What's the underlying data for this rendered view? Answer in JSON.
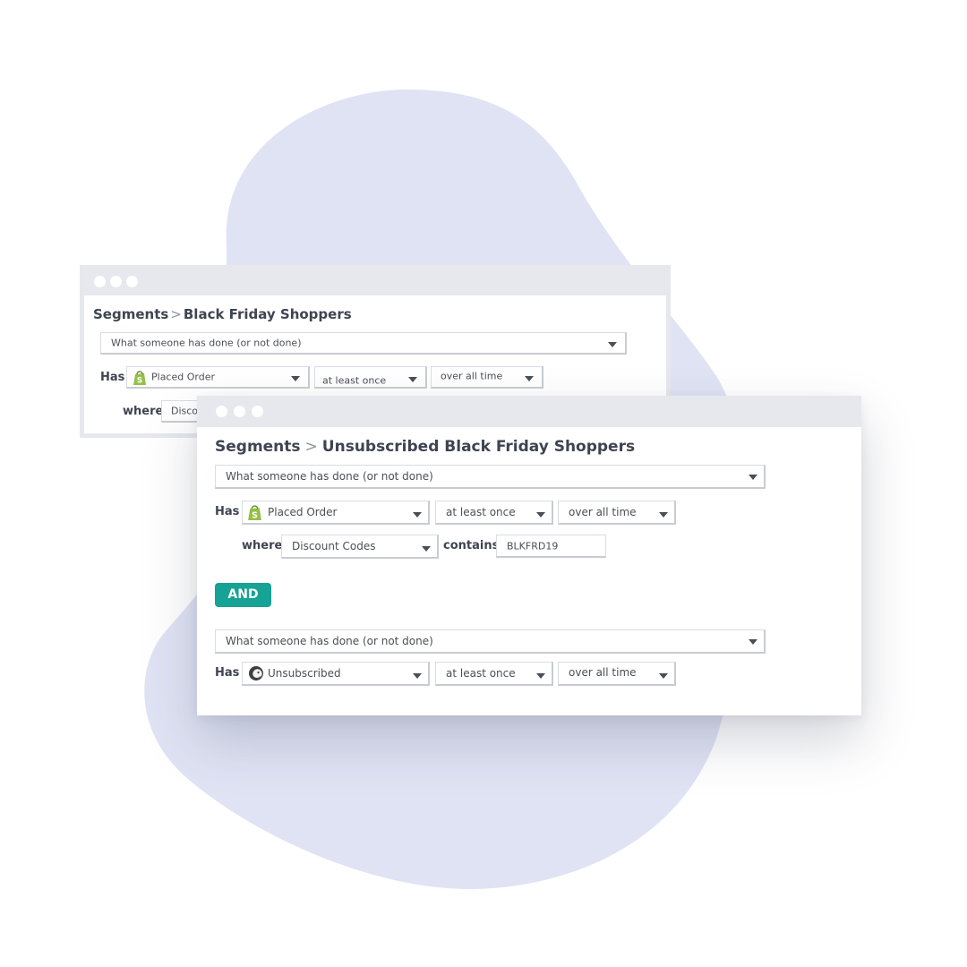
{
  "colors": {
    "blob": "#dfe3f4",
    "titlebar": "#e6e8ee",
    "accent": "#16a294",
    "text": "#3e4451",
    "shopify_green": "#95bf47"
  },
  "back_window": {
    "breadcrumb": {
      "root": "Segments",
      "separator": ">",
      "current": "Black Friday Shoppers"
    },
    "condition_type": "What someone has done (or not done)",
    "has_label": "Has",
    "metric": {
      "icon": "shopify-icon",
      "value": "Placed Order"
    },
    "frequency": "at least once",
    "timeframe": "over all time",
    "where_label": "where",
    "property_partial": "Disco"
  },
  "front_window": {
    "breadcrumb": {
      "root": "Segments",
      "separator": ">",
      "current": "Unsubscribed Black Friday Shoppers"
    },
    "condition1": {
      "type": "What someone has done (or not done)",
      "has_label": "Has",
      "metric": {
        "icon": "shopify-icon",
        "value": "Placed Order"
      },
      "frequency": "at least once",
      "timeframe": "over all time",
      "where_label": "where",
      "property": "Discount Codes",
      "operator_label": "contains",
      "filter_value": "BLKFRD19"
    },
    "and_label": "AND",
    "condition2": {
      "type": "What someone has done (or not done)",
      "has_label": "Has",
      "metric": {
        "icon": "mailchimp-icon",
        "value": "Unsubscribed"
      },
      "frequency": "at least once",
      "timeframe": "over all time"
    }
  }
}
